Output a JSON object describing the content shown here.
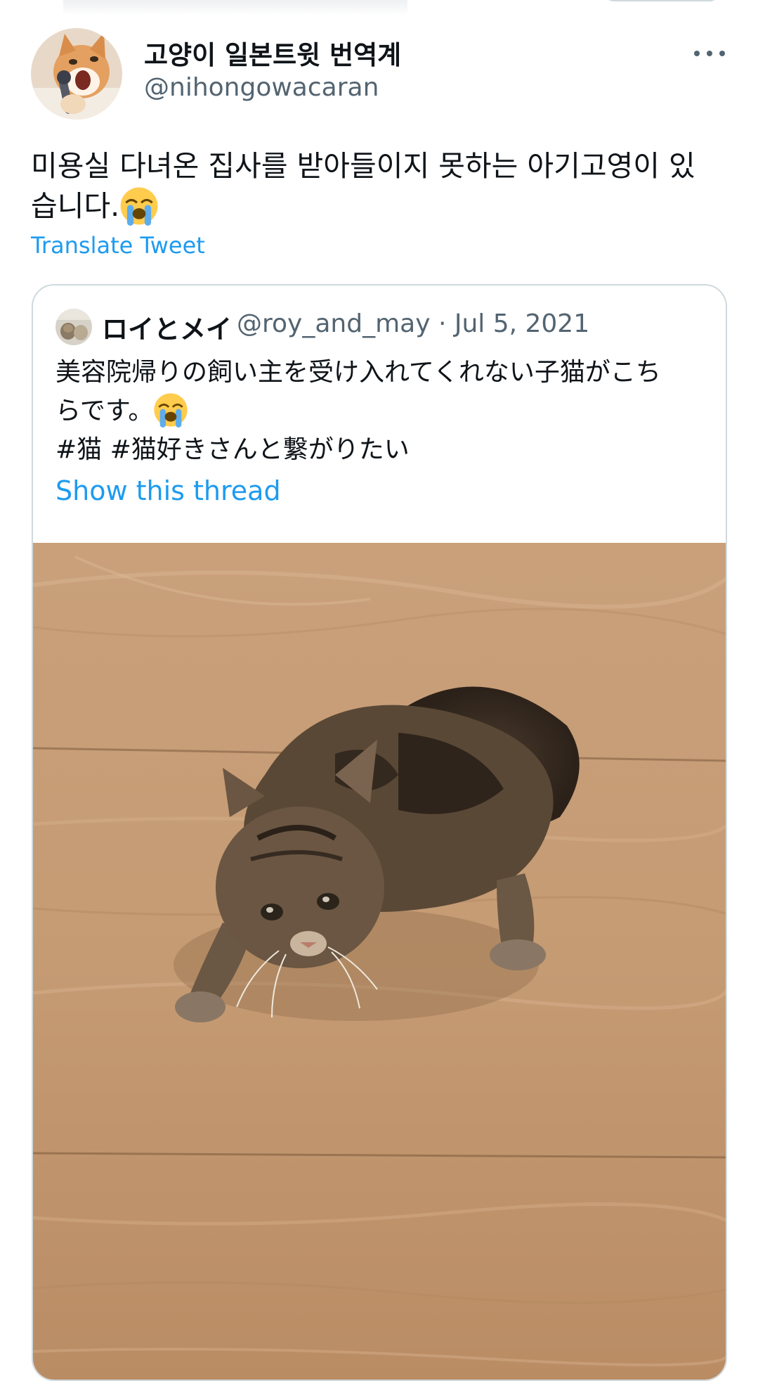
{
  "tweet": {
    "display_name": "고양이 일본트윗 번역계",
    "handle": "@nihongowacaran",
    "text_before_emoji": "미용실 다녀온 집사를 받아들이지 못하는 아기고영이 있\n습니다.",
    "emoji": "loudly-crying-face",
    "translate_label": "Translate Tweet",
    "more_icon": "more-horizontal-icon"
  },
  "quoted_tweet": {
    "display_name": "ロイとメイ",
    "handle_and_date": "@roy_and_may · Jul 5, 2021",
    "text_before_emoji": "美容院帰りの飼い主を受け入れてくれない子猫がこち\nらです。",
    "emoji": "loudly-crying-face",
    "hashtags": "#猫 #猫好きさんと繋がりたい",
    "show_thread_label": "Show this thread",
    "photo": "kitten-on-wooden-floor-photo"
  },
  "colors": {
    "link": "#1d9bf0",
    "secondary_text": "#536471",
    "border": "#cfd9de"
  }
}
